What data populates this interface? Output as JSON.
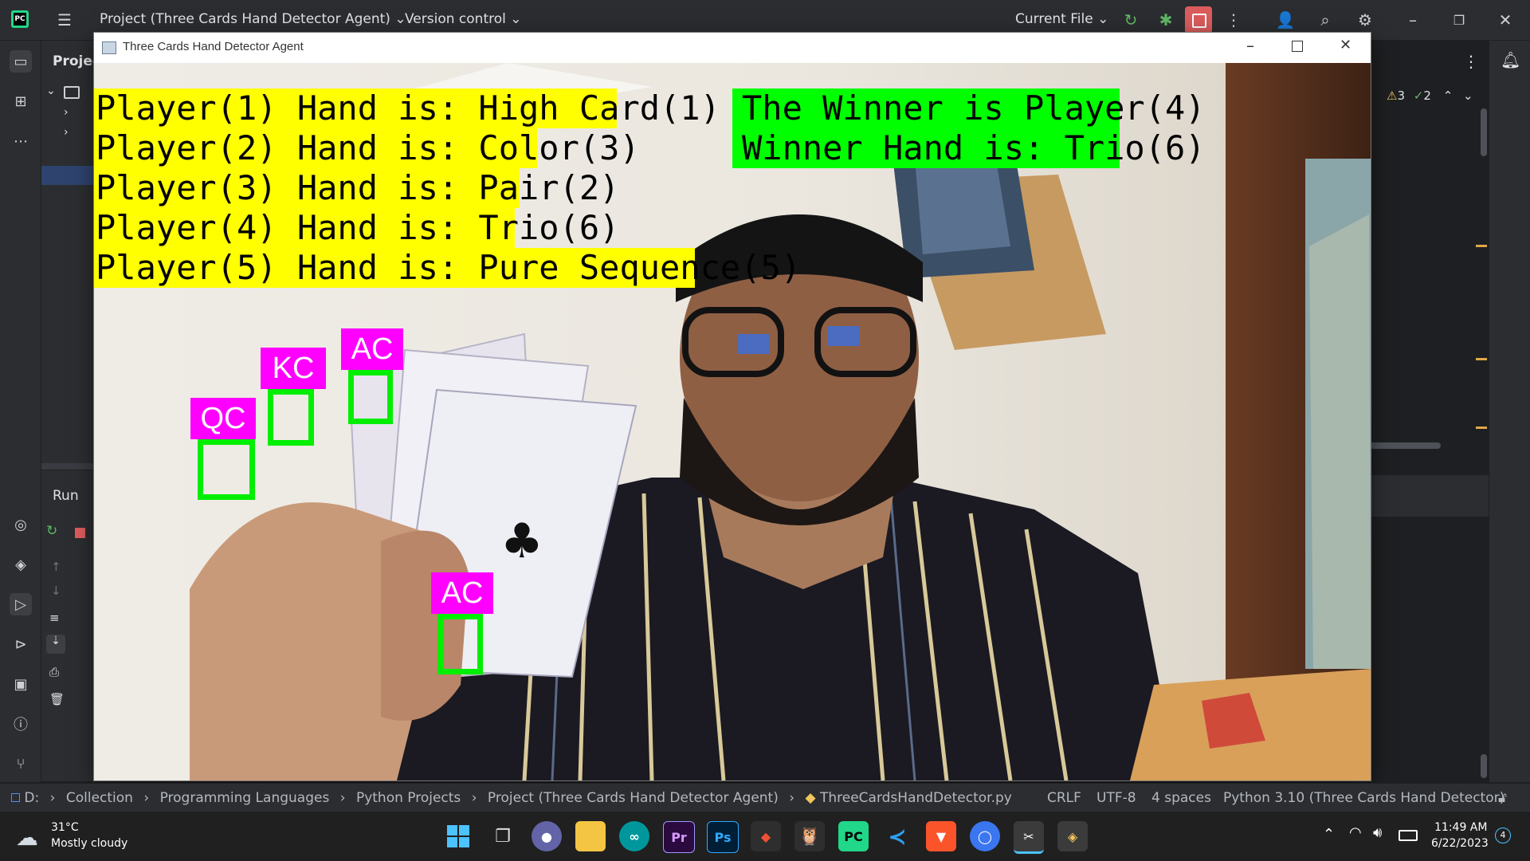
{
  "ide": {
    "project_menu": "Project (Three Cards Hand Detector Agent)",
    "vcs_menu": "Version control",
    "run_config": "Current File",
    "project_tab": "Projec",
    "run_tab": "Run",
    "inspections": {
      "warnings": "3",
      "weak_warnings": "2"
    }
  },
  "cv_window": {
    "title": "Three Cards Hand Detector Agent",
    "player_lines": [
      "Player(1) Hand is: High Card(1)",
      "Player(2) Hand is: Color(3)",
      "Player(3) Hand is: Pair(2)",
      "Player(4) Hand is: Trio(6)",
      "Player(5) Hand is: Pure Sequence(5)"
    ],
    "winner_lines": [
      "The Winner is Player(4)",
      "Winner Hand is: Trio(6)"
    ],
    "card_tags": [
      "QC",
      "KC",
      "AC",
      "AC"
    ]
  },
  "status_bar": {
    "breadcrumbs": [
      "D:",
      "Collection",
      "Programming Languages",
      "Python Projects",
      "Project (Three Cards Hand Detector Agent)",
      "ThreeCardsHandDetector.py"
    ],
    "line_sep": "CRLF",
    "encoding": "UTF-8",
    "indent": "4 spaces",
    "interpreter": "Python 3.10 (Three Cards Hand Detector)"
  },
  "taskbar": {
    "weather_temp": "31°C",
    "weather_desc": "Mostly cloudy",
    "time": "11:49 AM",
    "date": "6/22/2023",
    "notif_count": "4"
  },
  "colors": {
    "label_yellow": "#ffff00",
    "label_green": "#00ff00",
    "tag_magenta": "#ff00ff",
    "box_green": "#00ee00"
  }
}
